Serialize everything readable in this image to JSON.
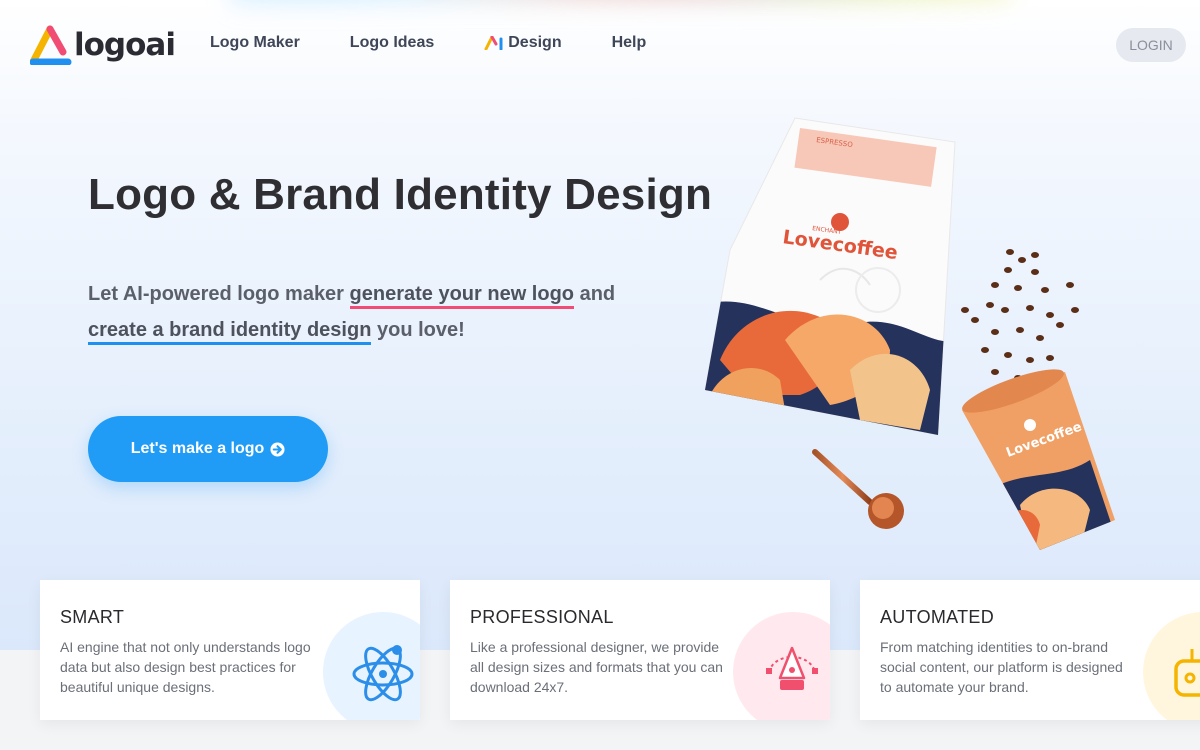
{
  "header": {
    "logo_text": "logoai",
    "nav": [
      {
        "label": "Logo Maker"
      },
      {
        "label": "Logo Ideas"
      },
      {
        "label": "Design"
      },
      {
        "label": "Help"
      }
    ],
    "login_label": "LOGIN"
  },
  "hero": {
    "title": "Logo & Brand Identity Design",
    "subtitle_part1": "Let AI-powered logo maker ",
    "subtitle_highlight1": "generate your new logo",
    "subtitle_part2": " and ",
    "subtitle_highlight2": "create a brand identity design",
    "subtitle_part3": " you love!",
    "cta_label": "Let's make a logo",
    "illustration": {
      "bag_label_top": "ESPRESSO",
      "bag_brand_small": "ENCHANT",
      "bag_brand": "Lovecoffee",
      "cup_brand": "Lovecoffee"
    }
  },
  "features": [
    {
      "title": "SMART",
      "description": "AI engine that not only understands logo data but also design best practices for beautiful unique designs.",
      "icon": "atom-icon",
      "blob_color": "#e7f3ff",
      "icon_color": "#2b8ee8"
    },
    {
      "title": "PROFESSIONAL",
      "description": "Like a professional designer, we provide all design sizes and formats that you can download 24x7.",
      "icon": "pen-tool-icon",
      "blob_color": "#ffe9ee",
      "icon_color": "#f0506e"
    },
    {
      "title": "AUTOMATED",
      "description": "From matching identities to on-brand social content, our platform is designed to automate your brand.",
      "icon": "robot-icon",
      "blob_color": "#fff6dd",
      "icon_color": "#f5b400"
    }
  ],
  "colors": {
    "accent": "#209cf7",
    "underline_red": "#f04c74",
    "underline_blue": "#1f8ff0"
  }
}
